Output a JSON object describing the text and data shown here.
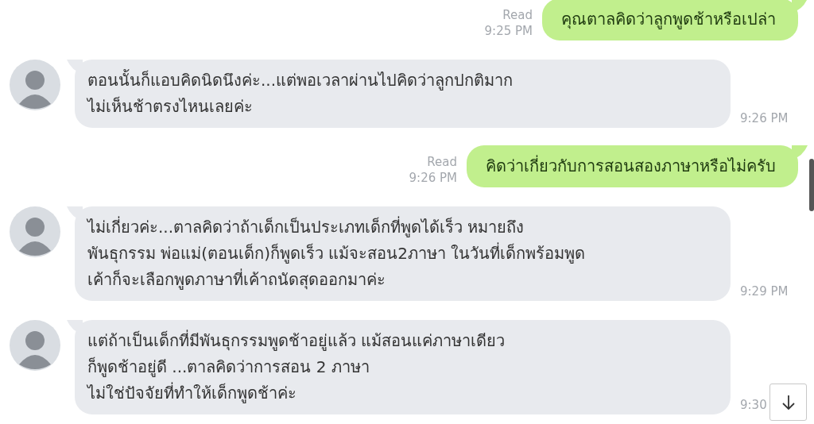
{
  "messages": [
    {
      "kind": "outgoing",
      "read": "Read",
      "time": "9:25 PM",
      "lines": [
        "คุณตาลคิดว่าลูกพูดช้าหรือเปล่า"
      ]
    },
    {
      "kind": "incoming",
      "time": "9:26 PM",
      "lines": [
        "ตอนนั้นก็แอบคิดนิดนึงค่ะ...แต่พอเวลาผ่านไปคิดว่าลูกปกติมาก",
        "ไม่เห็นช้าตรงไหนเลยค่ะ"
      ]
    },
    {
      "kind": "outgoing",
      "read": "Read",
      "time": "9:26 PM",
      "lines": [
        "คิดว่าเกี่ยวกับการสอนสองภาษาหรือไม่ครับ"
      ]
    },
    {
      "kind": "incoming",
      "time": "9:29 PM",
      "lines": [
        "ไม่เกี่ยวค่ะ...ตาลคิดว่าถ้าเด็กเป็นประเภทเด็กที่พูดได้เร็ว หมายถึง",
        "พันธุกรรม พ่อแม่(ตอนเด็ก)ก็พูดเร็ว แม้จะสอน2ภาษา ในวันที่เด็กพร้อมพูด",
        "เค้าก็จะเลือกพูดภาษาที่เค้าถนัดสุดออกมาค่ะ"
      ]
    },
    {
      "kind": "incoming",
      "time": "9:30",
      "lines": [
        "แต่ถ้าเป็นเด็กที่มีพันธุกรรมพูดช้าอยู่แล้ว แม้สอนแค่ภาษาเดียว",
        "ก็พูดช้าอยู่ดี ...ตาลคิดว่าการสอน 2 ภาษา",
        "ไม่ใช่ปัจจัยที่ทำให้เด็กพูดช้าค่ะ"
      ]
    }
  ]
}
